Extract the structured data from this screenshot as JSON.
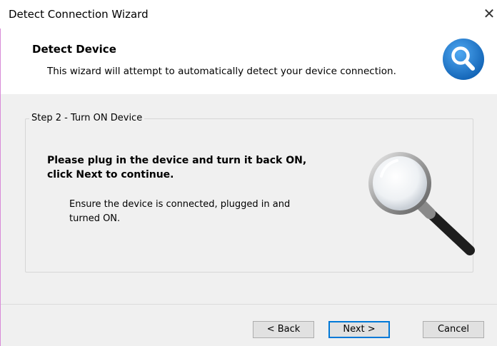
{
  "window": {
    "title": "Detect Connection Wizard",
    "close_glyph": "✕"
  },
  "header": {
    "title": "Detect Device",
    "description": "This wizard will attempt to automatically detect your device connection.",
    "icon": "search-icon"
  },
  "step": {
    "legend": "Step 2 - Turn ON Device",
    "instruction": "Please plug in the device and turn it back ON,  click Next to continue.",
    "note": "Ensure the device is connected, plugged in and turned ON.",
    "illustration": "magnifying-glass"
  },
  "buttons": {
    "back": "< Back",
    "next": "Next >",
    "cancel": "Cancel"
  },
  "colors": {
    "accent": "#0078d7",
    "header_icon": "#1a73c8",
    "panel": "#f0f0f0"
  }
}
